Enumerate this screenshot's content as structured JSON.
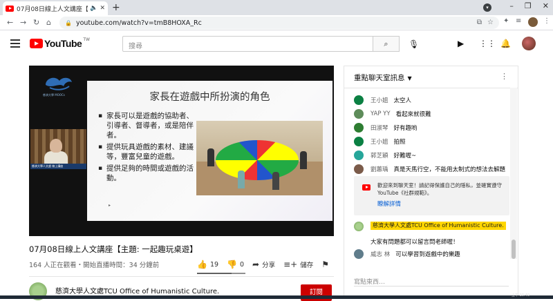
{
  "browser": {
    "tab_title": "07月08日線上人文講座【主",
    "url": "youtube.com/watch?v=tmB8HOXA_Rc"
  },
  "youtube": {
    "logo_text": "YouTube",
    "logo_region": "TW",
    "search_placeholder": "搜尋"
  },
  "video": {
    "slide_title": "家長在遊戲中所扮演的角色",
    "slide_bullets": [
      "家長可以是遊戲的協助者、引導者、督導者，或是陪伴者。",
      "提供玩具遊戲的素材、建議等，豐富兒童的遊戲。",
      "提供足夠的時間或遊戲的活動。"
    ],
    "logo_caption": "慈濟大學 MOOCs",
    "cam_caption": "慈濟大學人文處 線上講座",
    "title": "07月08日線上人文講座【主題: 一起趣玩桌遊】",
    "meta": "164 人正在觀看・開始直播時間：34 分鐘前",
    "likes": "19",
    "dislikes": "0",
    "share": "分享",
    "save": "儲存"
  },
  "channel": {
    "name": "慈濟大學人文處TCU Office of Humanistic Culture.",
    "subscribe": "訂閱"
  },
  "chat": {
    "header": "重點聊天室訊息",
    "messages": [
      {
        "author": "王小姐",
        "text": "太空人",
        "color": "#0b8043"
      },
      {
        "author": "YAP YY",
        "text": "看起來就很難",
        "color": "#5e8c5a"
      },
      {
        "author": "田淑琴",
        "text": "好有趣哟",
        "color": "#2e7d32"
      },
      {
        "author": "王小姐",
        "text": "拍照",
        "color": "#0b8043"
      },
      {
        "author": "郭芝穎",
        "text": "好難喔~",
        "color": "#26a69a"
      },
      {
        "author": "劉蕙瑀",
        "text": "真是天馬行空，不能用太制式的想法去解題",
        "color": "#7b5b4a"
      }
    ],
    "notice_text": "歡迎來到聊天室！請記得保護自己的隱私，並確實遵守 YouTube《社群規範》。",
    "notice_link": "瞭解詳情",
    "owner_name": "慈濟大學人文處TCU Office of Humanistic Culture.",
    "owner_text": "大家有問題都可以留言問老師喔！",
    "last_author": "威志 林",
    "last_text": "可以學習到遊戲中的樂趣",
    "input_placeholder": "寫點東西…"
  },
  "taskbar_clock": "上午 10:40"
}
